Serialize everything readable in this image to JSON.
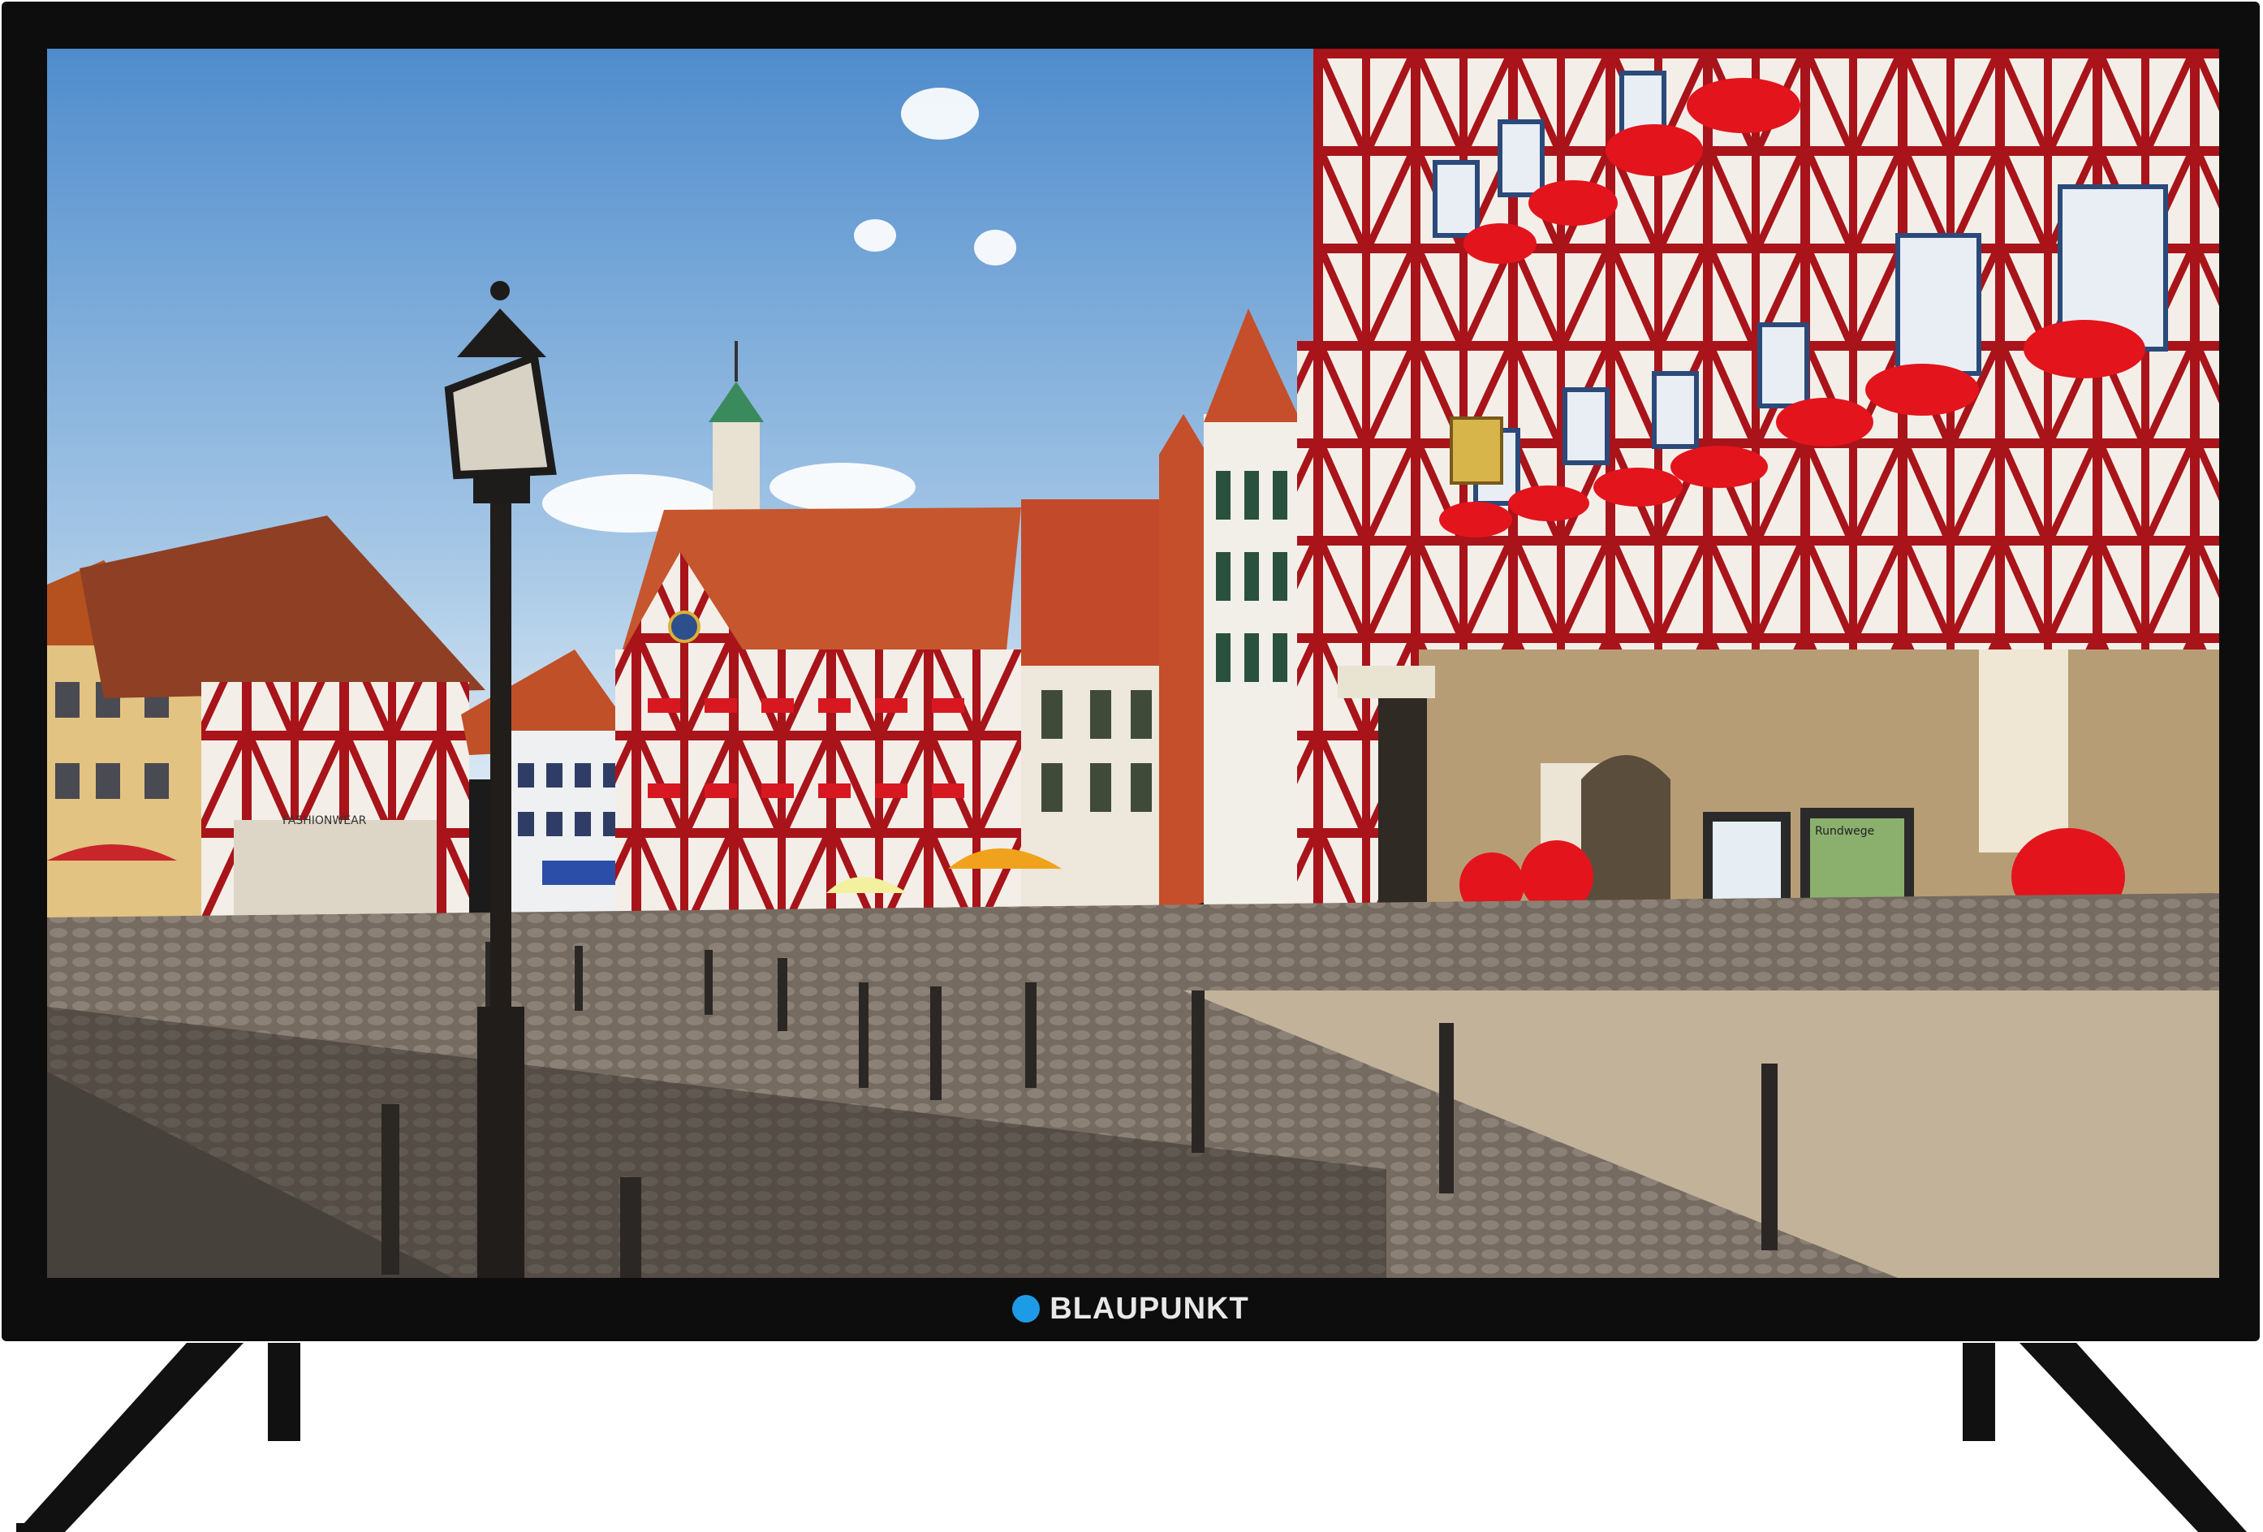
{
  "tv": {
    "brand_name": "BLAUPUNKT",
    "brand_dot_color": "#1e9be6",
    "frame_color": "#0d0d0d"
  },
  "screen_content": {
    "signs": {
      "shop_sign": "FASHIONWEAR",
      "board_sign": "Rundwege"
    },
    "colors": {
      "sky_top": "#5a94cf",
      "sky_bottom": "#cfe2f2",
      "timber": "#b0131a",
      "plaster": "#f3f0ea",
      "roof": "#c24a2a",
      "cobble": "#6f665c",
      "flowers": "#e3141c",
      "stone": "#b89f79"
    }
  }
}
